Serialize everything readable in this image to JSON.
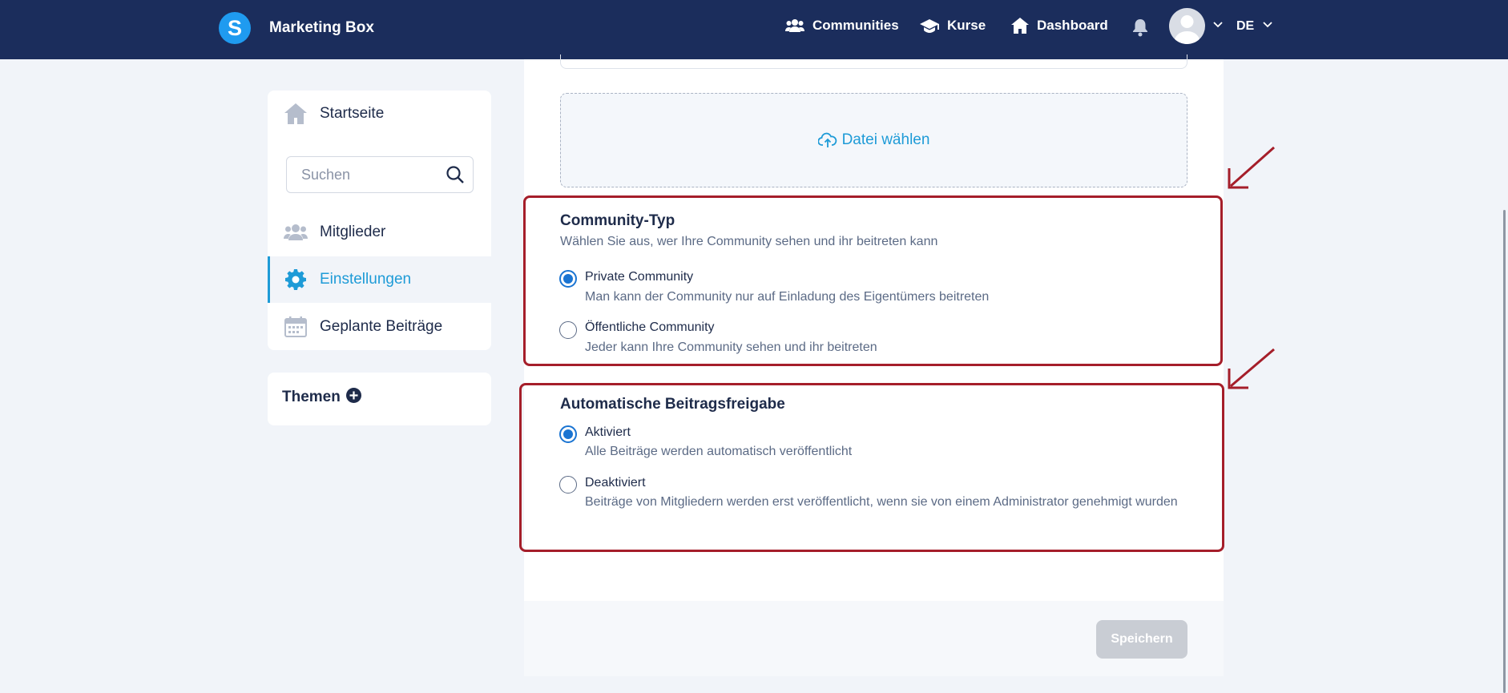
{
  "topbar": {
    "brand": "Marketing Box",
    "logo_letter": "S",
    "nav": [
      {
        "label": "Communities",
        "icon": "users-icon"
      },
      {
        "label": "Kurse",
        "icon": "graduation-cap-icon"
      },
      {
        "label": "Dashboard",
        "icon": "home-icon"
      }
    ],
    "language": "DE",
    "colors": {
      "bar": "#1b2d5c",
      "logo": "#1f9bf0"
    }
  },
  "sidebar": {
    "items": [
      {
        "label": "Startseite",
        "icon": "home-icon"
      },
      {
        "label": "Mitglieder",
        "icon": "users-icon"
      },
      {
        "label": "Einstellungen",
        "icon": "gear-icon",
        "active": true
      },
      {
        "label": "Geplante Beiträge",
        "icon": "calendar-icon"
      }
    ],
    "search_placeholder": "Suchen",
    "topics_label": "Themen"
  },
  "main": {
    "upload_label": "Datei wählen",
    "community_type": {
      "title": "Community-Typ",
      "subtitle": "Wählen Sie aus, wer Ihre Community sehen und ihr beitreten kann",
      "options": [
        {
          "title": "Private Community",
          "desc": "Man kann der Community nur auf Einladung des Eigentümers beitreten",
          "checked": true
        },
        {
          "title": "Öffentliche Community",
          "desc": "Jeder kann Ihre Community sehen und ihr beitreten",
          "checked": false
        }
      ]
    },
    "auto_approval": {
      "title": "Automatische Beitragsfreigabe",
      "options": [
        {
          "title": "Aktiviert",
          "desc": "Alle Beiträge werden automatisch veröffentlicht",
          "checked": true
        },
        {
          "title": "Deaktiviert",
          "desc": "Beiträge von Mitgliedern werden erst veröffentlicht, wenn sie von einem Administrator genehmigt wurden",
          "checked": false
        }
      ]
    },
    "save_label": "Speichern",
    "accent": "#1e9bd7",
    "highlight": "#a51e2a"
  }
}
